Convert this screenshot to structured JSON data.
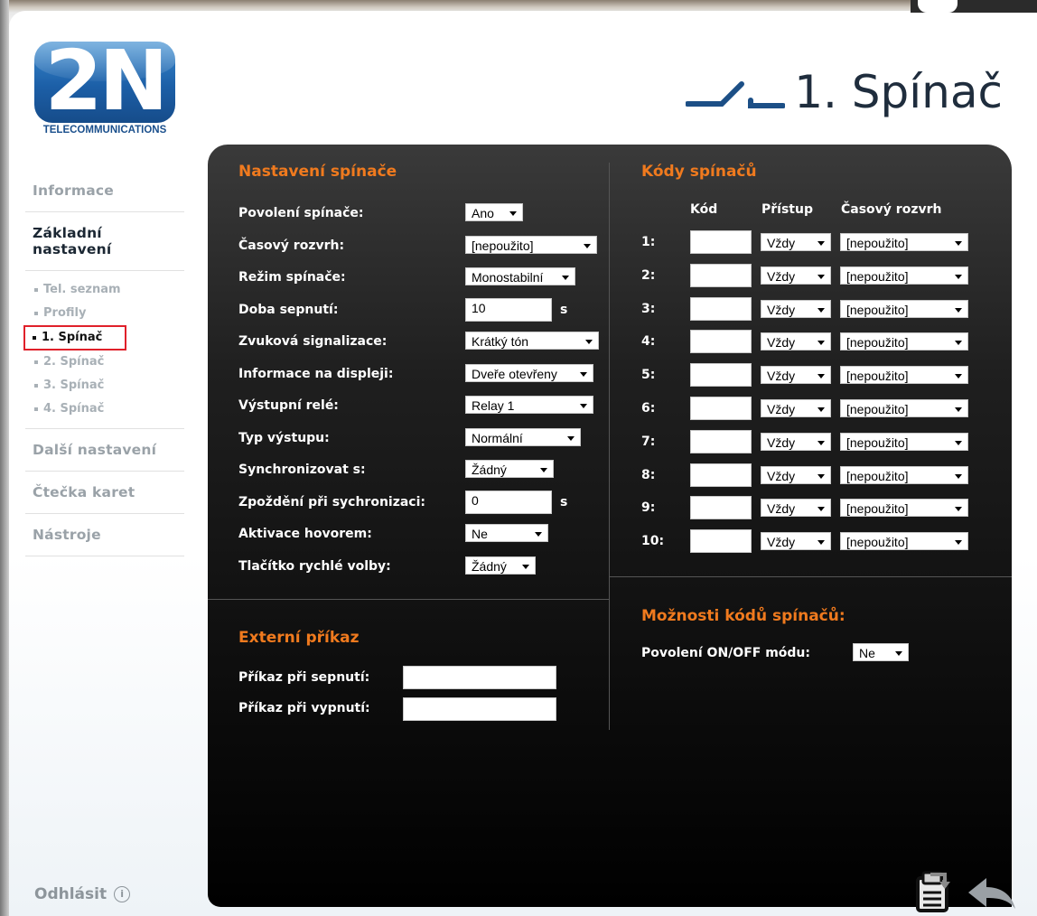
{
  "logo": {
    "text": "2N",
    "subtitle": "TELECOMMUNICATIONS"
  },
  "page_title": "1. Spínač",
  "nav": {
    "informace": "Informace",
    "zakladni": "Základní nastavení",
    "sub": [
      "Tel. seznam",
      "Profily",
      "1. Spínač",
      "2. Spínač",
      "3. Spínač",
      "4. Spínač"
    ],
    "dalsi": "Další nastavení",
    "ctecka": "Čtečka karet",
    "nastroje": "Nástroje",
    "logout": "Odhlásit"
  },
  "settings": {
    "title": "Nastavení spínače",
    "rows": [
      {
        "label": "Povolení spínače:",
        "value": "Ano",
        "type": "select"
      },
      {
        "label": "Časový rozvrh:",
        "value": "[nepoužito]",
        "type": "select"
      },
      {
        "label": "Režim spínače:",
        "value": "Monostabilní",
        "type": "select"
      },
      {
        "label": "Doba sepnutí:",
        "value": "10",
        "type": "input",
        "unit": "s"
      },
      {
        "label": "Zvuková signalizace:",
        "value": "Krátký tón",
        "type": "select"
      },
      {
        "label": "Informace na displeji:",
        "value": "Dveře otevřeny",
        "type": "select"
      },
      {
        "label": "Výstupní relé:",
        "value": "Relay 1",
        "type": "select"
      },
      {
        "label": "Typ výstupu:",
        "value": "Normální",
        "type": "select"
      },
      {
        "label": "Synchronizovat s:",
        "value": "Žádný",
        "type": "select"
      },
      {
        "label": "Zpoždění při sychronizaci:",
        "value": "0",
        "type": "input",
        "unit": "s"
      },
      {
        "label": "Aktivace hovorem:",
        "value": "Ne",
        "type": "select"
      },
      {
        "label": "Tlačítko rychlé volby:",
        "value": "Žádný",
        "type": "select"
      }
    ]
  },
  "external": {
    "title": "Externí příkaz",
    "on_label": "Příkaz při sepnutí:",
    "on_value": "",
    "off_label": "Příkaz při vypnutí:",
    "off_value": ""
  },
  "codes": {
    "title": "Kódy spínačů",
    "headers": {
      "code": "Kód",
      "access": "Přístup",
      "schedule": "Časový rozvrh"
    },
    "rows": [
      {
        "num": "1:",
        "code": "",
        "access": "Vždy",
        "schedule": "[nepoužito]"
      },
      {
        "num": "2:",
        "code": "",
        "access": "Vždy",
        "schedule": "[nepoužito]"
      },
      {
        "num": "3:",
        "code": "",
        "access": "Vždy",
        "schedule": "[nepoužito]"
      },
      {
        "num": "4:",
        "code": "",
        "access": "Vždy",
        "schedule": "[nepoužito]"
      },
      {
        "num": "5:",
        "code": "",
        "access": "Vždy",
        "schedule": "[nepoužito]"
      },
      {
        "num": "6:",
        "code": "",
        "access": "Vždy",
        "schedule": "[nepoužito]"
      },
      {
        "num": "7:",
        "code": "",
        "access": "Vždy",
        "schedule": "[nepoužito]"
      },
      {
        "num": "8:",
        "code": "",
        "access": "Vždy",
        "schedule": "[nepoužito]"
      },
      {
        "num": "9:",
        "code": "",
        "access": "Vždy",
        "schedule": "[nepoužito]"
      },
      {
        "num": "10:",
        "code": "",
        "access": "Vždy",
        "schedule": "[nepoužito]"
      }
    ]
  },
  "code_options": {
    "title": "Možnosti kódů spínačů:",
    "onoff_label": "Povolení ON/OFF módu:",
    "onoff_value": "Ne"
  },
  "colors": {
    "accent": "#f07a1e",
    "panel": "#1f1f1f",
    "logo_blue": "#1c5fa7",
    "highlight_border": "#e0202a"
  },
  "icons": {
    "title": "switch-icon",
    "save": "save-icon",
    "back": "back-arrow-icon",
    "logout": "info-icon"
  }
}
